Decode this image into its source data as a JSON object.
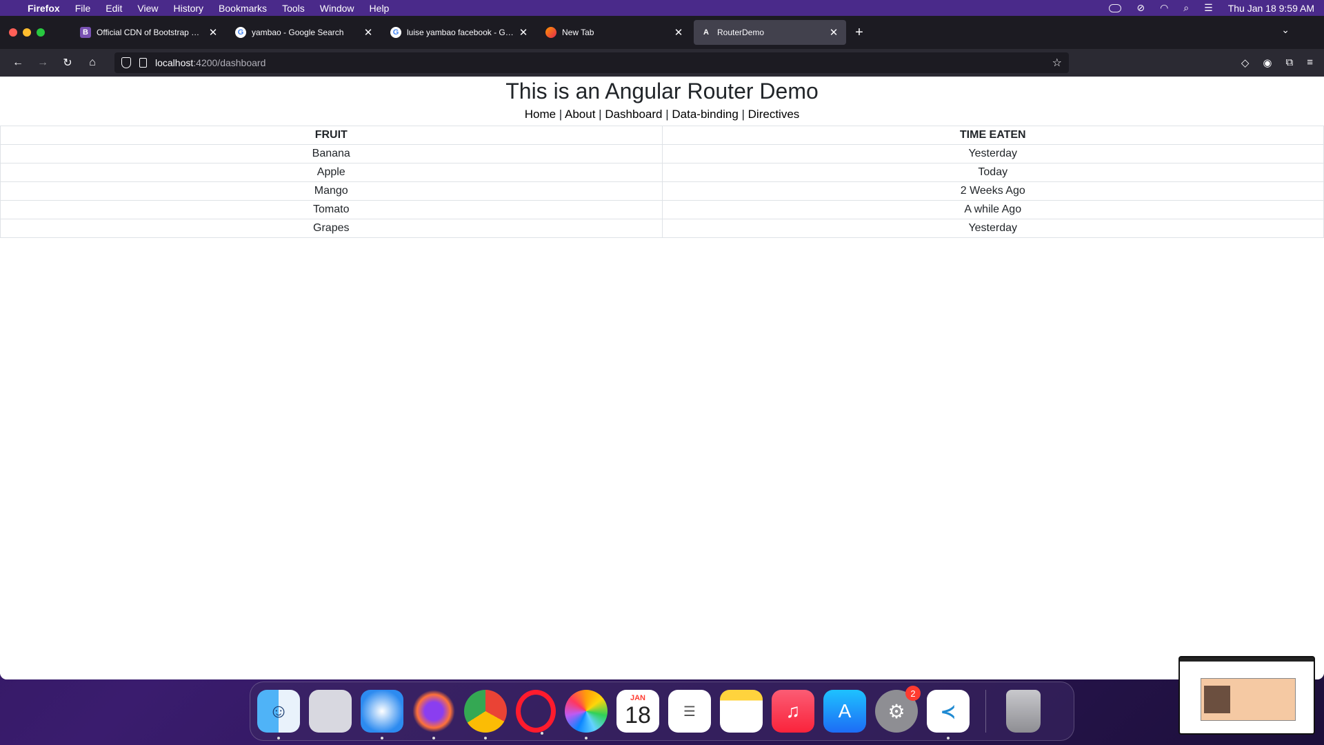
{
  "menubar": {
    "app_name": "Firefox",
    "items": [
      "File",
      "Edit",
      "View",
      "History",
      "Bookmarks",
      "Tools",
      "Window",
      "Help"
    ],
    "datetime": "Thu Jan 18  9:59 AM"
  },
  "tabs": [
    {
      "title": "Official CDN of Bootstrap and F",
      "favicon": "bootstrap-icon",
      "active": false
    },
    {
      "title": "yambao - Google Search",
      "favicon": "google-icon",
      "active": false
    },
    {
      "title": "luise yambao facebook - Google",
      "favicon": "google-icon",
      "active": false
    },
    {
      "title": "New Tab",
      "favicon": "firefox-icon",
      "active": false
    },
    {
      "title": "RouterDemo",
      "favicon": "angular-icon",
      "active": true
    }
  ],
  "urlbar": {
    "host": "localhost",
    "path": ":4200/dashboard"
  },
  "page": {
    "title": "This is an Angular Router Demo",
    "nav": [
      "Home",
      "About",
      "Dashboard",
      "Data-binding",
      "Directives"
    ],
    "nav_separator": " | ",
    "table": {
      "headers": [
        "FRUIT",
        "TIME EATEN"
      ],
      "rows": [
        [
          "Banana",
          "Yesterday"
        ],
        [
          "Apple",
          "Today"
        ],
        [
          "Mango",
          "2 Weeks Ago"
        ],
        [
          "Tomato",
          "A while Ago"
        ],
        [
          "Grapes",
          "Yesterday"
        ]
      ]
    }
  },
  "dock": {
    "calendar_month": "JAN",
    "calendar_day": "18",
    "settings_badge": "2"
  },
  "colors": {
    "menubar": "#4a2a8a",
    "tabstrip": "#1c1b22",
    "navbar": "#2b2a33",
    "active_tab": "#42414d"
  }
}
